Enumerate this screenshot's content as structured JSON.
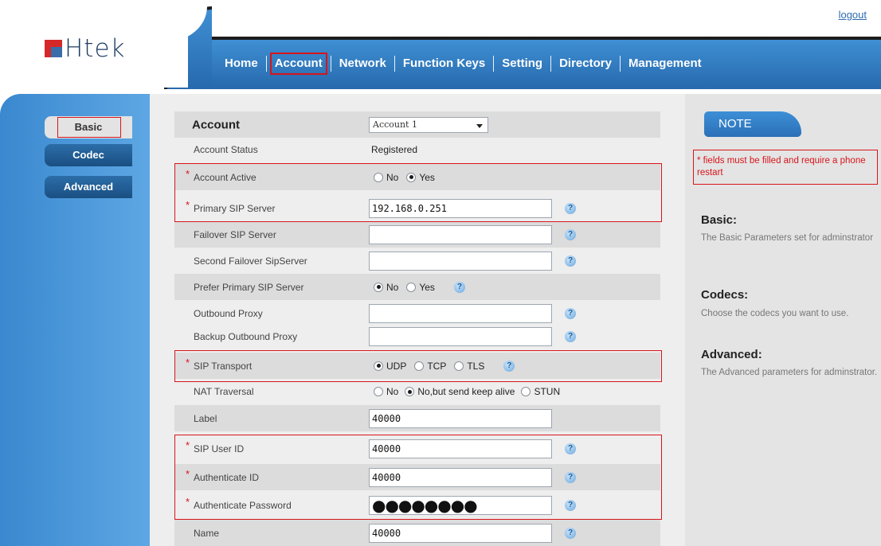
{
  "header": {
    "logo_text": "Htek",
    "logout": "logout",
    "nav": [
      {
        "label": "Home"
      },
      {
        "label": "Account"
      },
      {
        "label": "Network"
      },
      {
        "label": "Function Keys"
      },
      {
        "label": "Setting"
      },
      {
        "label": "Directory"
      },
      {
        "label": "Management"
      }
    ],
    "active_nav": "Account"
  },
  "sidebar": {
    "items": [
      {
        "label": "Basic"
      },
      {
        "label": "Codec"
      },
      {
        "label": "Advanced"
      }
    ],
    "active": "Basic"
  },
  "form": {
    "account": {
      "label": "Account",
      "selected": "Account 1"
    },
    "account_status": {
      "label": "Account Status",
      "value": "Registered"
    },
    "account_active": {
      "label": "Account Active",
      "options": [
        "No",
        "Yes"
      ],
      "selected": "Yes"
    },
    "primary_sip_server": {
      "label": "Primary SIP Server",
      "value": "192.168.0.251"
    },
    "failover_sip_server": {
      "label": "Failover SIP Server",
      "value": ""
    },
    "second_failover": {
      "label": "Second Failover SipServer",
      "value": ""
    },
    "prefer_primary": {
      "label": "Prefer Primary SIP Server",
      "options": [
        "No",
        "Yes"
      ],
      "selected": "No"
    },
    "outbound_proxy": {
      "label": "Outbound Proxy",
      "value": ""
    },
    "backup_outbound_proxy": {
      "label": "Backup Outbound Proxy",
      "value": ""
    },
    "sip_transport": {
      "label": "SIP Transport",
      "options": [
        "UDP",
        "TCP",
        "TLS"
      ],
      "selected": "UDP"
    },
    "nat_traversal": {
      "label": "NAT Traversal",
      "options": [
        "No",
        "No,but send keep alive",
        "STUN"
      ],
      "selected": "No,but send keep alive"
    },
    "label_field": {
      "label": "Label",
      "value": "40000"
    },
    "sip_user_id": {
      "label": "SIP User ID",
      "value": "40000"
    },
    "authenticate_id": {
      "label": "Authenticate ID",
      "value": "40000"
    },
    "authenticate_password": {
      "label": "Authenticate Password",
      "value": "●●●●●●●●"
    },
    "name": {
      "label": "Name",
      "value": "40000"
    },
    "required_mark": "*",
    "help_glyph": "?"
  },
  "note": {
    "tab": "NOTE",
    "required_text": "* fields must be filled and require a phone restart",
    "sections": [
      {
        "title": "Basic:",
        "desc": "The Basic Parameters set for adminstrator"
      },
      {
        "title": "Codecs:",
        "desc": "Choose the codecs you want to use."
      },
      {
        "title": "Advanced:",
        "desc": "The Advanced parameters for adminstrator."
      }
    ]
  },
  "colors": {
    "brand_blue": "#2f7cbf",
    "highlight_red": "#d8141a",
    "required_red": "#d8141a"
  }
}
